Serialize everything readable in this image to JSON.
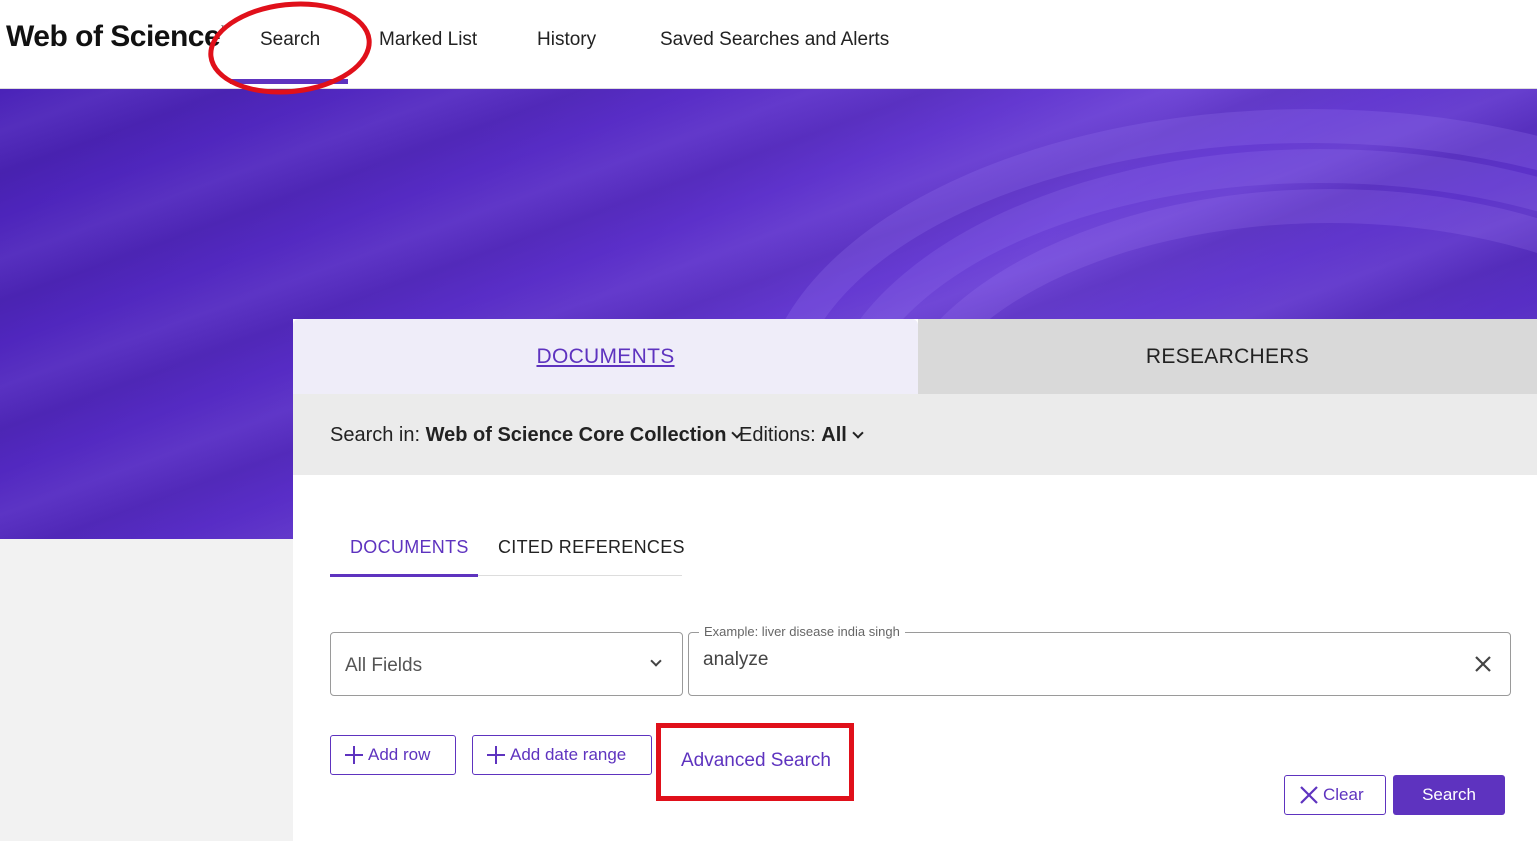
{
  "brand": {
    "name": "Web of Science",
    "mark": "™"
  },
  "nav": {
    "items": [
      {
        "label": "Search"
      },
      {
        "label": "Marked List"
      },
      {
        "label": "History"
      },
      {
        "label": "Saved Searches and Alerts"
      }
    ],
    "active": "Search"
  },
  "main_tabs": {
    "documents": "DOCUMENTS",
    "researchers": "RESEARCHERS",
    "active": "DOCUMENTS"
  },
  "search_in": {
    "label": "Search in:",
    "value": "Web of Science Core Collection",
    "editions_label": "Editions:",
    "editions_value": "All"
  },
  "sub_tabs": {
    "documents": "DOCUMENTS",
    "cited_references": "CITED REFERENCES",
    "active": "DOCUMENTS"
  },
  "query_row": {
    "field": "All Fields",
    "example_label": "Example: liver disease india singh",
    "value": "analyze"
  },
  "actions": {
    "add_row": "Add row",
    "add_date_range": "Add date range",
    "advanced_search": "Advanced Search",
    "clear": "Clear",
    "search": "Search"
  },
  "colors": {
    "accent": "#5e33bf",
    "annotation": "#e0101a",
    "hero": "#5b2fc9"
  }
}
